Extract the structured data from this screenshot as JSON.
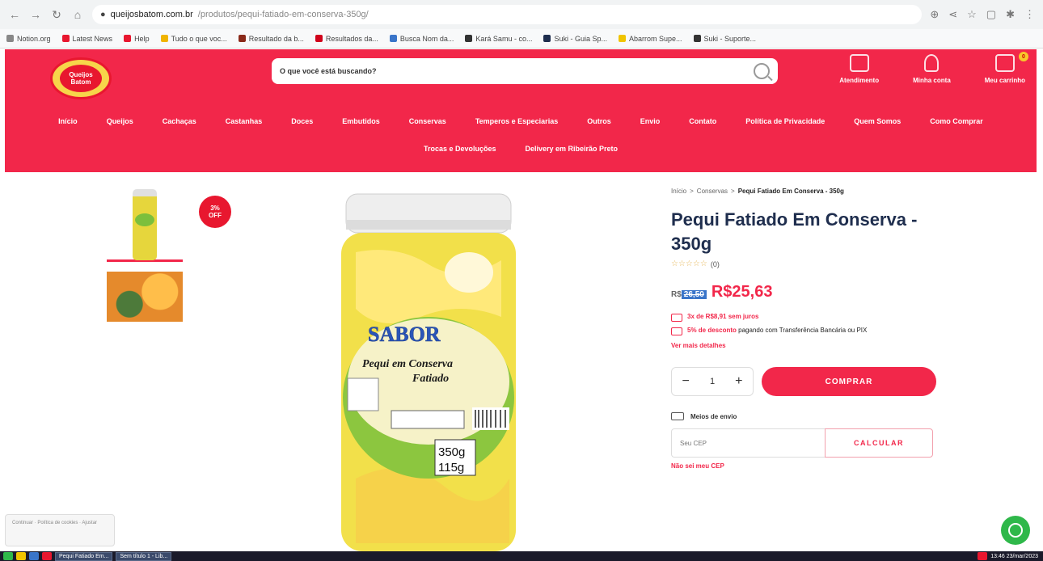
{
  "browser": {
    "url_host": "queijosbatom.com.br",
    "url_path": "/produtos/pequi-fatiado-em-conserva-350g/",
    "bookmarks": [
      {
        "label": "Notion.org",
        "color": "#888888"
      },
      {
        "label": "Latest News",
        "color": "#e8172f"
      },
      {
        "label": "Help",
        "color": "#e8172f"
      },
      {
        "label": "Tudo o que voc...",
        "color": "#f0b400"
      },
      {
        "label": "Resultado da b...",
        "color": "#8a2a1a"
      },
      {
        "label": "Resultados da...",
        "color": "#d0021b"
      },
      {
        "label": "Busca Nom da...",
        "color": "#3a75c9"
      },
      {
        "label": "Kará Samu - co...",
        "color": "#333333"
      },
      {
        "label": "Suki - Guia Sp...",
        "color": "#1f2e4e"
      },
      {
        "label": "Abarrom Supe...",
        "color": "#f0c400"
      },
      {
        "label": "Suki - Suporte...",
        "color": "#333333"
      }
    ]
  },
  "header": {
    "logo_text": "Queijos Batom",
    "search_placeholder": "O que você está buscando?",
    "actions": [
      {
        "label": "Atendimento",
        "icon": "chat-icon"
      },
      {
        "label": "Minha conta",
        "icon": "user-icon"
      },
      {
        "label": "Meu carrinho",
        "icon": "cart-icon",
        "badge": "0"
      }
    ],
    "nav": [
      "Início",
      "Queijos",
      "Cachaças",
      "Castanhas",
      "Doces",
      "Embutidos",
      "Conservas",
      "Temperos e Especiarias",
      "Outros",
      "Envio",
      "Contato",
      "Política de Privacidade",
      "Quem Somos",
      "Como Comprar",
      "Trocas e Devoluções",
      "Delivery em Ribeirão Preto"
    ]
  },
  "product": {
    "discount_badge_pct": "3%",
    "discount_badge_label": "OFF",
    "breadcrumb": [
      "Início",
      "Conservas",
      "Pequi Fatiado Em Conserva - 350g"
    ],
    "title": "Pequi Fatiado Em Conserva - 350g",
    "stars": "☆☆☆☆☆",
    "rating_count": "(0)",
    "old_price_prefix": "R$",
    "old_price": "26,50",
    "price": "R$25,63",
    "installments": "3x de R$8,91 sem juros",
    "pix_bold": "5% de desconto",
    "pix_rest": "pagando com Transferência Bancária ou PIX",
    "more_details": "Ver mais detalhes",
    "quantity": "1",
    "buy_label": "COMPRAR",
    "shipping_label": "Meios de envio",
    "cep_placeholder": "Seu CEP",
    "calc_label": "CALCULAR",
    "cep_link": "Não sei meu CEP",
    "jar_brand": "SABOR",
    "jar_line1": "Pequi em Conserva",
    "jar_line2": "Fatiado",
    "jar_weight1": "350g",
    "jar_weight2": "115g"
  },
  "cookie_text": "Continuar · Política de cookies · Ajustar",
  "taskbar": {
    "tasks": [
      "Pequi Fatiado Em...",
      "Sem título 1 - Lib..."
    ],
    "clock": "13:46 23/mar/2023"
  }
}
